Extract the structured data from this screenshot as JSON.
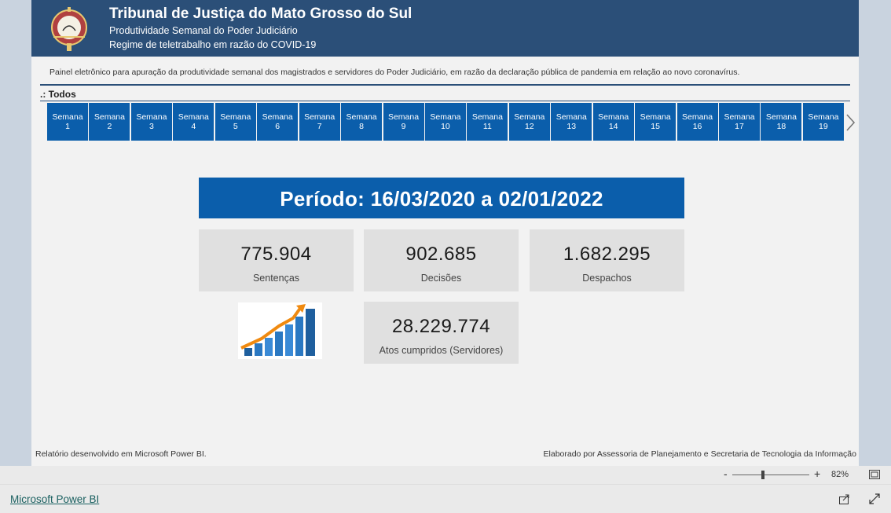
{
  "header": {
    "title": "Tribunal de Justiça do Mato Grosso do Sul",
    "subtitle1": "Produtividade Semanal do Poder Judiciário",
    "subtitle2": "Regime de teletrabalho em razão do COVID-19",
    "logo_icon": "court-seal-icon"
  },
  "description": "Painel eletrônico para apuração da produtividade semanal dos magistrados e servidores do Poder Judiciário, em razão da declaração pública de pandemia em relação ao novo coronavírus.",
  "slicer": {
    "title": ".: Todos",
    "weeks": [
      {
        "line1": "Semana",
        "line2": "1"
      },
      {
        "line1": "Semana",
        "line2": "2"
      },
      {
        "line1": "Semana",
        "line2": "3"
      },
      {
        "line1": "Semana",
        "line2": "4"
      },
      {
        "line1": "Semana",
        "line2": "5"
      },
      {
        "line1": "Semana",
        "line2": "6"
      },
      {
        "line1": "Semana",
        "line2": "7"
      },
      {
        "line1": "Semana",
        "line2": "8"
      },
      {
        "line1": "Semana",
        "line2": "9"
      },
      {
        "line1": "Semana",
        "line2": "10"
      },
      {
        "line1": "Semana",
        "line2": "11"
      },
      {
        "line1": "Semana",
        "line2": "12"
      },
      {
        "line1": "Semana",
        "line2": "13"
      },
      {
        "line1": "Semana",
        "line2": "14"
      },
      {
        "line1": "Semana",
        "line2": "15"
      },
      {
        "line1": "Semana",
        "line2": "16"
      },
      {
        "line1": "Semana",
        "line2": "17"
      },
      {
        "line1": "Semana",
        "line2": "18"
      },
      {
        "line1": "Semana",
        "line2": "19"
      }
    ],
    "next_icon": "chevron-right-icon"
  },
  "periodo": "Período: 16/03/2020 a 02/01/2022",
  "cards": {
    "sentencas": {
      "value": "775.904",
      "label": "Sentenças"
    },
    "decisoes": {
      "value": "902.685",
      "label": "Decisões"
    },
    "despachos": {
      "value": "1.682.295",
      "label": "Despachos"
    },
    "atos": {
      "value": "28.229.774",
      "label": "Atos cumpridos (Servidores)"
    }
  },
  "footer": {
    "left": "Relatório desenvolvido em Microsoft Power BI.",
    "right": "Elaborado por Assessoria de Planejamento e Secretaria de Tecnologia da Informação"
  },
  "zoom": {
    "minus": "-",
    "plus": "+",
    "value": "82%",
    "fit_icon": "fit-to-page-icon"
  },
  "bottombar": {
    "link": "Microsoft Power BI",
    "share_icon": "share-icon",
    "expand_icon": "expand-icon"
  },
  "colors": {
    "header": "#2b4f78",
    "accent": "#0b5eab",
    "card": "#e0e0e0"
  }
}
